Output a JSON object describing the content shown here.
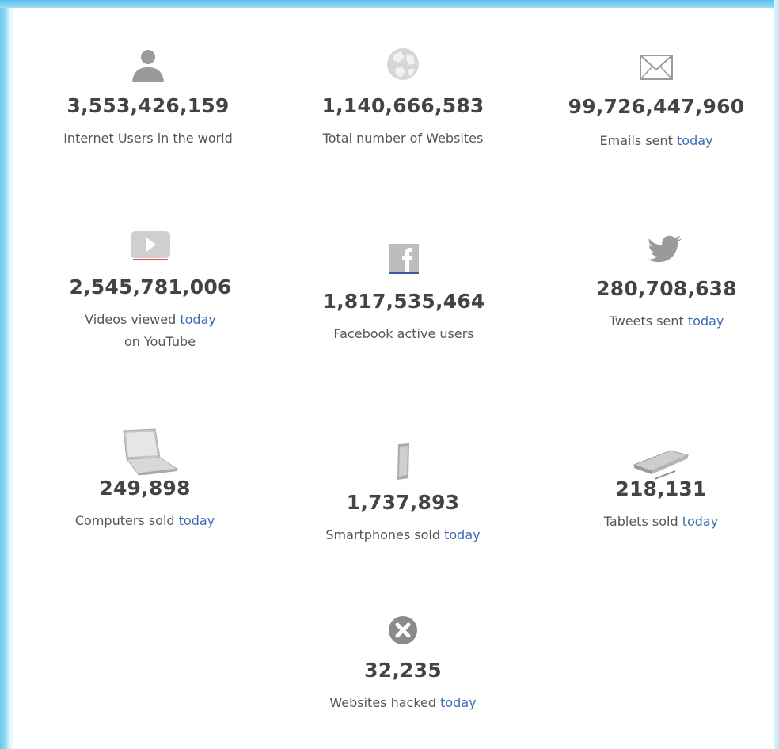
{
  "colors": {
    "number": "#444444",
    "label": "#555555",
    "link": "#3a6bb5",
    "icon": "#9a9a9a",
    "frame": "#6cc9ec"
  },
  "stats": {
    "internet_users": {
      "icon": "user-icon",
      "value": "3,553,426,159",
      "label": "Internet Users in the world"
    },
    "websites": {
      "icon": "globe-icon",
      "value": "1,140,666,583",
      "label": "Total number of Websites"
    },
    "emails": {
      "icon": "envelope-icon",
      "value": "99,726,447,960",
      "label": "Emails sent",
      "link": "today"
    },
    "videos": {
      "icon": "youtube-icon",
      "value": "2,545,781,006",
      "label": "Videos viewed",
      "link": "today",
      "label2": "on YouTube"
    },
    "facebook": {
      "icon": "facebook-icon",
      "value": "1,817,535,464",
      "label": "Facebook active users"
    },
    "tweets": {
      "icon": "twitter-icon",
      "value": "280,708,638",
      "label": "Tweets sent",
      "link": "today"
    },
    "computers": {
      "icon": "laptop-icon",
      "value": "249,898",
      "label": "Computers sold",
      "link": "today"
    },
    "smartphones": {
      "icon": "smartphone-icon",
      "value": "1,737,893",
      "label": "Smartphones sold",
      "link": "today"
    },
    "tablets": {
      "icon": "tablet-icon",
      "value": "218,131",
      "label": "Tablets sold",
      "link": "today"
    },
    "hacked": {
      "icon": "x-circle-icon",
      "value": "32,235",
      "label": "Websites hacked",
      "link": "today"
    }
  }
}
